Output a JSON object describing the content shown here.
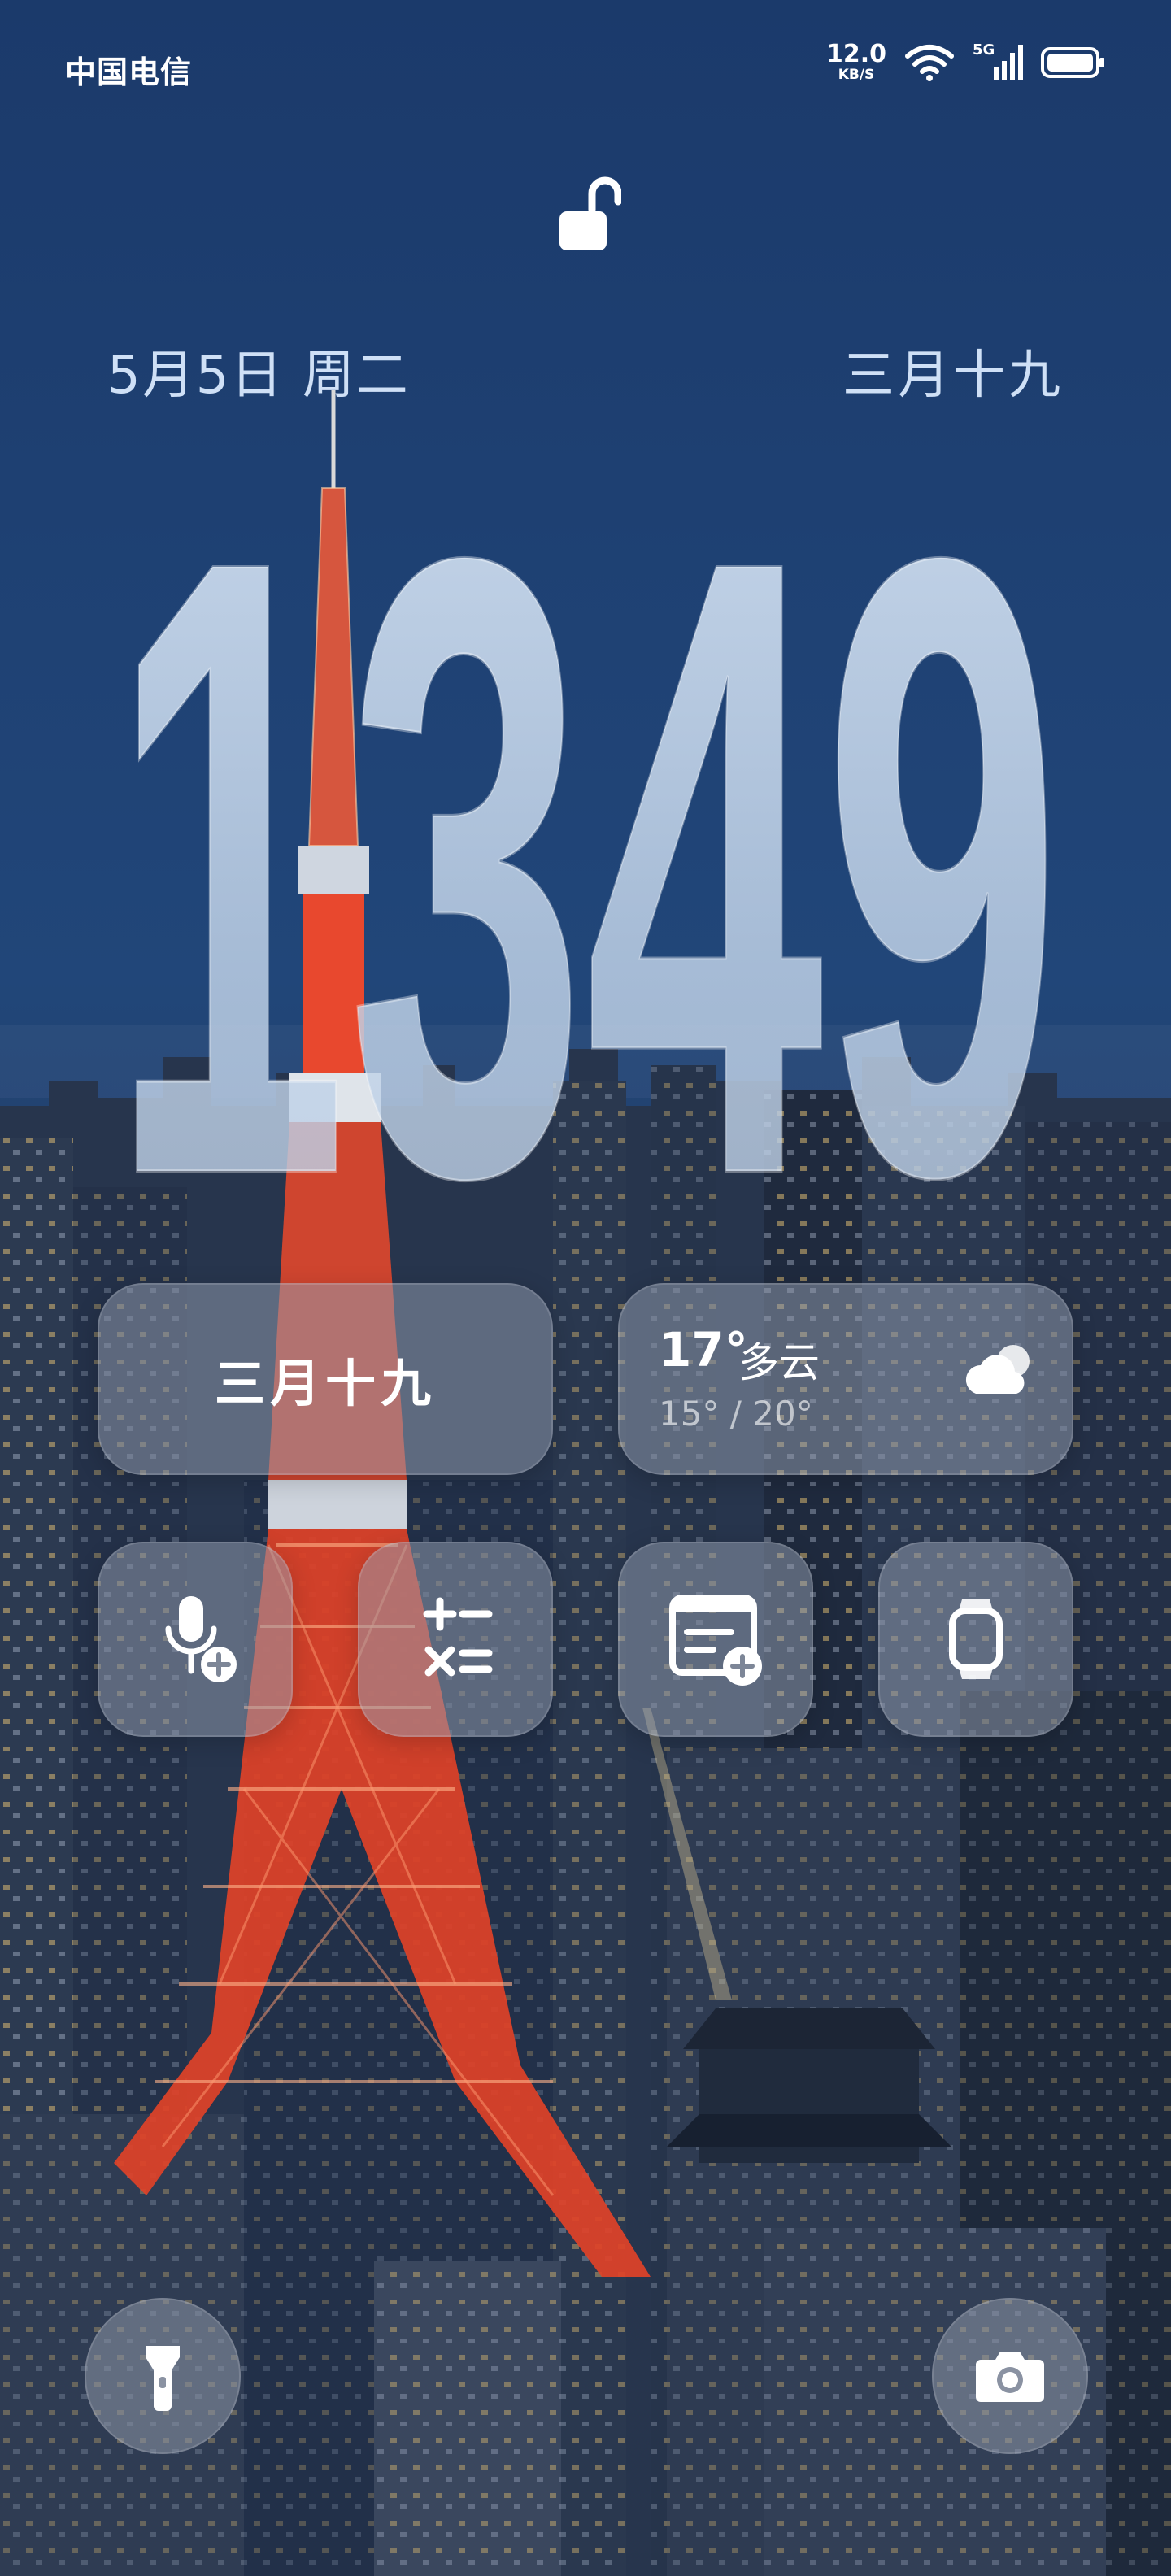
{
  "status_bar": {
    "carrier": "中国电信",
    "net_speed": "12.0",
    "net_speed_unit": "KB/S",
    "network_type": "5G",
    "icons": [
      "wifi-icon",
      "signal-icon",
      "battery-icon"
    ]
  },
  "lock_icon": "unlock-icon",
  "date": {
    "solar": "5月5日 周二",
    "lunar": "三月十九"
  },
  "clock": {
    "time": "1349"
  },
  "widgets": {
    "lunar": {
      "text": "三月十九"
    },
    "weather": {
      "temp": "17°",
      "condition": "多云",
      "range": "15° / 20°",
      "icon": "cloud-icon"
    }
  },
  "shortcuts": [
    {
      "name": "voice-recorder",
      "icon": "mic-plus-icon"
    },
    {
      "name": "calculator",
      "icon": "calculator-icon"
    },
    {
      "name": "new-note",
      "icon": "note-plus-icon"
    },
    {
      "name": "watch",
      "icon": "smartwatch-icon"
    }
  ],
  "bottom": {
    "left": "flashlight-icon",
    "right": "camera-icon"
  },
  "colors": {
    "sky_top": "#1d3d6e",
    "sky_bottom": "#24487c",
    "clock_fill": "#cfe0f3",
    "tower_red": "#e0402a"
  }
}
